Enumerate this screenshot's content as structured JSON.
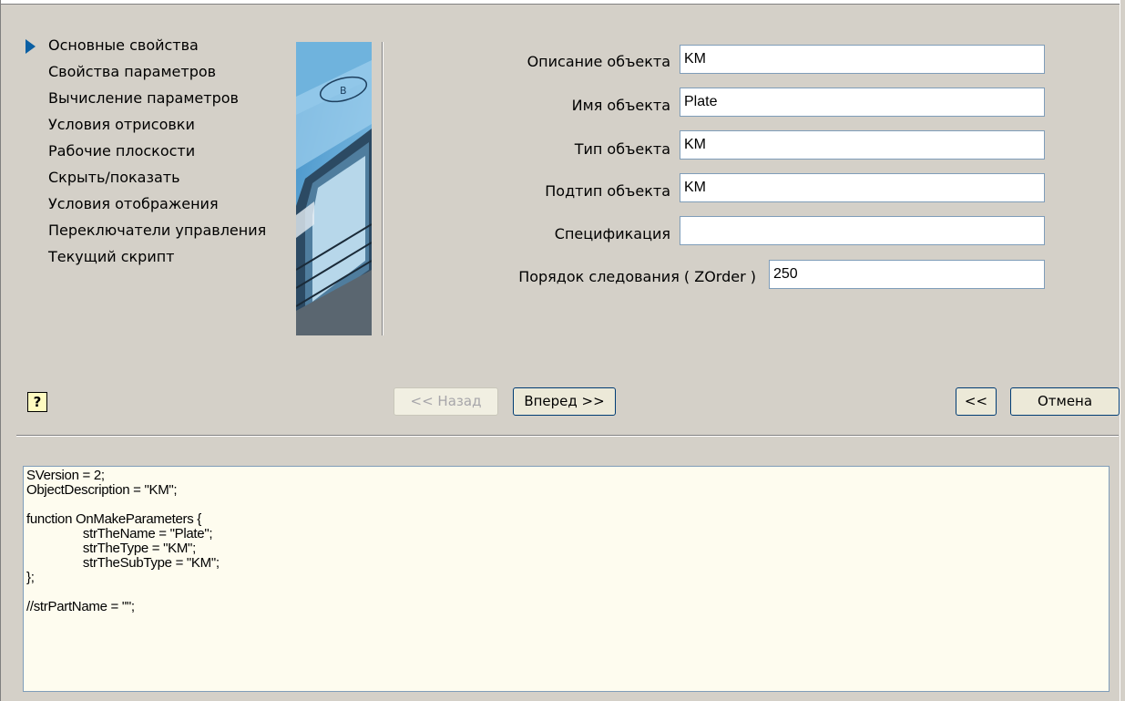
{
  "nav": {
    "items": [
      {
        "label": "Основные свойства",
        "active": true
      },
      {
        "label": "Свойства параметров",
        "active": false
      },
      {
        "label": "Вычисление параметров",
        "active": false
      },
      {
        "label": "Условия отрисовки",
        "active": false
      },
      {
        "label": "Рабочие плоскости",
        "active": false
      },
      {
        "label": "Скрыть/показать",
        "active": false
      },
      {
        "label": "Условия отображения",
        "active": false
      },
      {
        "label": "Переключатели управления",
        "active": false
      },
      {
        "label": "Текущий скрипт",
        "active": false
      }
    ]
  },
  "form": {
    "description": {
      "label": "Описание объекта",
      "value": "KM"
    },
    "name": {
      "label": "Имя объекта",
      "value": "Plate"
    },
    "type": {
      "label": "Тип объекта",
      "value": "KM"
    },
    "subtype": {
      "label": "Подтип объекта",
      "value": "KM"
    },
    "specification": {
      "label": "Спецификация",
      "value": ""
    },
    "zorder": {
      "label": "Порядок следования ( ZOrder )",
      "value": "250"
    }
  },
  "buttons": {
    "help": "?",
    "back": "<< Назад",
    "next": "Вперед >>",
    "collapse": "<<",
    "cancel": "Отмена"
  },
  "script": {
    "text": "SVersion = 2;\nObjectDescription = \"KM\";\n\nfunction OnMakeParameters {\n\t\tstrTheName = \"Plate\";\n\t\tstrTheType = \"KM\";\n\t\tstrTheSubType = \"KM\";\n};\n\n//strPartName = \"\";"
  },
  "colors": {
    "dialog_bg": "#d4d0c8",
    "accent_arrow": "#0a5fa3",
    "script_bg": "#fefcef"
  }
}
